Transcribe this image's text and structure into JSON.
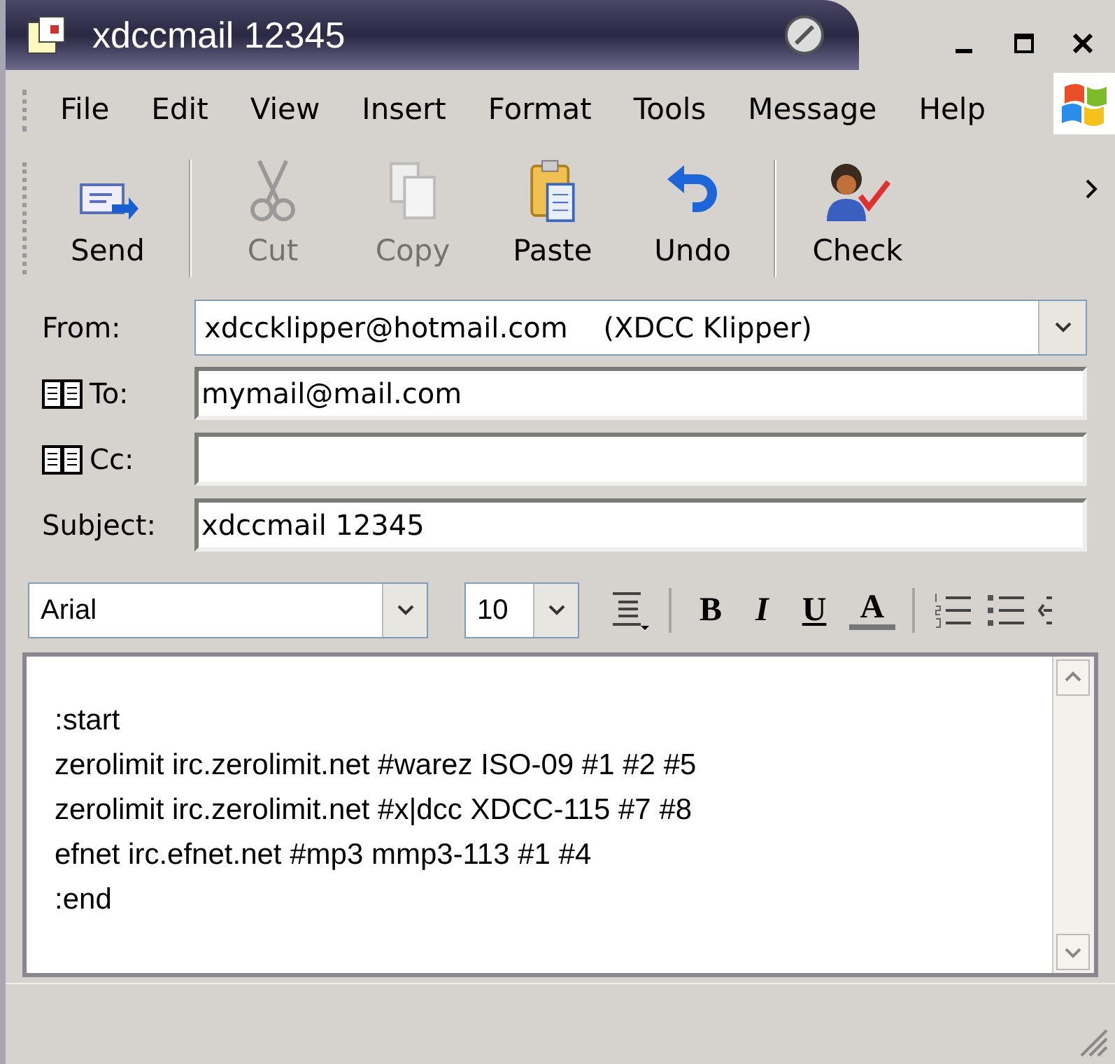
{
  "window": {
    "title": "xdccmail 12345"
  },
  "menu": [
    "File",
    "Edit",
    "View",
    "Insert",
    "Format",
    "Tools",
    "Message",
    "Help"
  ],
  "toolbar": [
    {
      "kind": "send",
      "label": "Send",
      "disabled": false
    },
    {
      "kind": "cut",
      "label": "Cut",
      "disabled": true
    },
    {
      "kind": "copy",
      "label": "Copy",
      "disabled": true
    },
    {
      "kind": "paste",
      "label": "Paste",
      "disabled": false
    },
    {
      "kind": "undo",
      "label": "Undo",
      "disabled": false
    },
    {
      "kind": "check",
      "label": "Check",
      "disabled": false
    }
  ],
  "fields": [
    {
      "kind": "dropdown",
      "label": "From:",
      "value": "xdccklipper@hotmail.com    (XDCC Klipper)"
    },
    {
      "kind": "book",
      "label": "To:",
      "value": "mymail@mail.com"
    },
    {
      "kind": "book",
      "label": "Cc:"
    },
    {
      "kind": "plain",
      "label": "Subject:",
      "value": "xdccmail 12345"
    }
  ],
  "format_bar": {
    "font": "Arial",
    "size": "10",
    "bold": "B",
    "italic": "I",
    "underline": "U",
    "font_color": "A"
  },
  "body": {
    "lines": [
      ":start",
      "zerolimit irc.zerolimit.net #warez ISO-09 #1 #2 #5",
      "zerolimit irc.zerolimit.net #x|dcc XDCC-115 #7 #8",
      "efnet irc.efnet.net #mp3 mmp3-113 #1 #4",
      ":end"
    ]
  }
}
